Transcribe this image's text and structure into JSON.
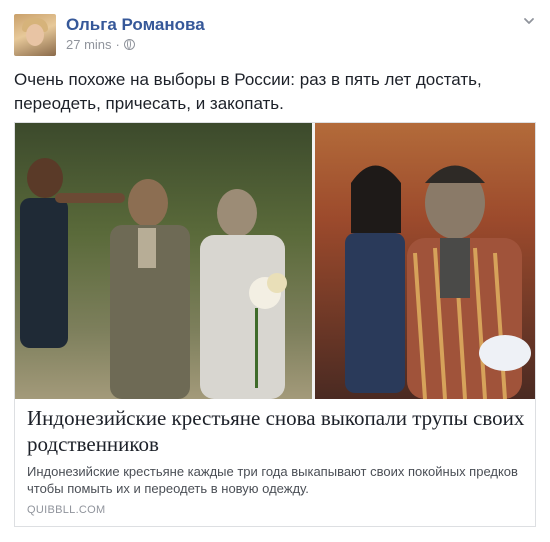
{
  "post": {
    "author_name": "Ольга Романова",
    "timestamp": "27 mins",
    "separator": "·",
    "privacy_icon": "globe-icon",
    "menu_icon": "chevron-down-icon",
    "text": "Очень похоже на выборы в России: раз в пять лет достать, переодеть, причесать, и закопать."
  },
  "link_card": {
    "title": "Индонезийские крестьяне снова выкопали трупы своих родственников",
    "description": "Индонезийские крестьяне каждые три года выкапывают своих покойных предков чтобы помыть их и переодеть в новую одежду.",
    "domain": "QUIBBLL.COM"
  },
  "colors": {
    "author_link": "#365899",
    "meta_text": "#90949c",
    "body_text": "#1d2129",
    "card_border": "#dddfe2"
  }
}
